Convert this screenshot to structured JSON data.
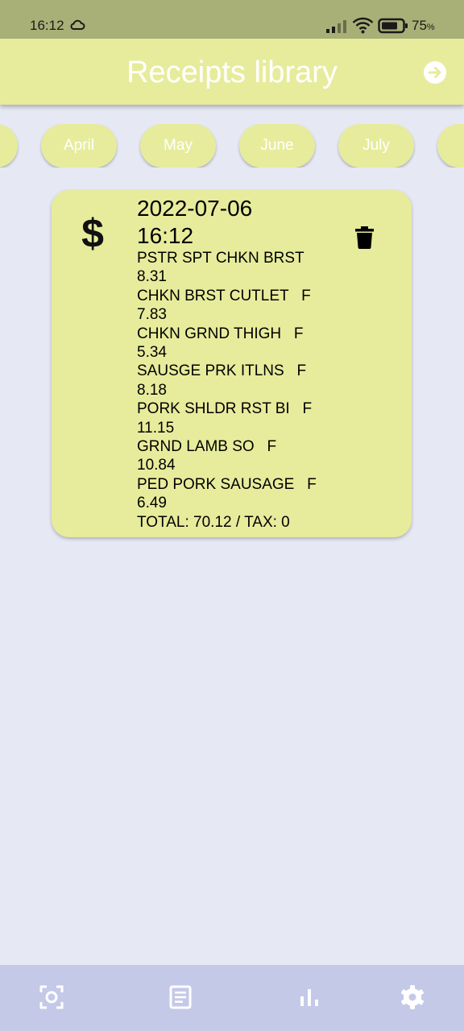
{
  "status_bar": {
    "time": "16:12",
    "battery": "75",
    "battery_unit": "%"
  },
  "app_bar": {
    "title": "Receipts library",
    "forward_icon": "arrow-right-circle-icon"
  },
  "months": [
    "April",
    "May",
    "June",
    "July"
  ],
  "receipt": {
    "date": "2022-07-06 16:12",
    "lines": [
      "PSTR SPT CHKN BRST",
      "8.31",
      "CHKN BRST CUTLET   F",
      "7.83",
      "CHKN GRND THIGH   F",
      "5.34",
      "SAUSGE PRK ITLNS   F",
      "8.18",
      "PORK SHLDR RST BI   F",
      "11.15",
      "GRND LAMB SO   F",
      "10.84",
      "PED PORK SAUSAGE   F",
      "6.49",
      "TOTAL: 70.12 / TAX: 0"
    ],
    "icon": "dollar-icon",
    "delete_icon": "trash-icon"
  },
  "bottom_nav": {
    "items": [
      "scan-icon",
      "receipts-list-icon",
      "stats-chart-icon",
      "settings-gear-icon"
    ]
  },
  "colors": {
    "status_bar": "#a9b077",
    "accent": "#e7ec9c",
    "background": "#e6e9f4",
    "bottom_nav": "#c5c9e8"
  }
}
